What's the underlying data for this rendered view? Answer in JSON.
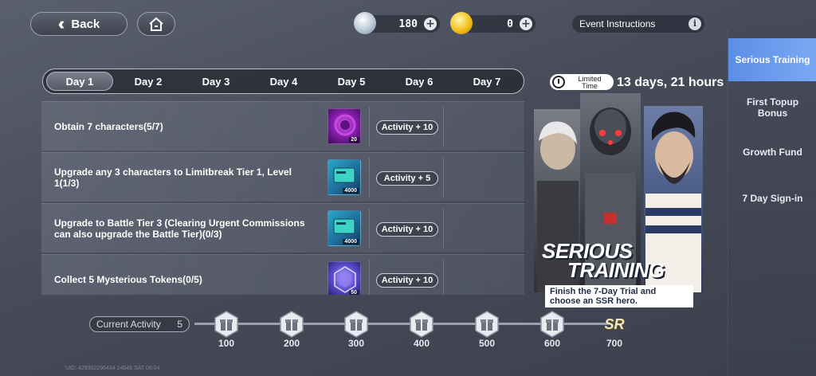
{
  "topbar": {
    "back_label": "Back",
    "silver_amount": "180",
    "gold_amount": "0",
    "event_instructions_label": "Event Instructions"
  },
  "sidebar": {
    "items": [
      {
        "label": "Serious Training",
        "active": true
      },
      {
        "label": "First Topup Bonus",
        "active": false
      },
      {
        "label": "Growth Fund",
        "active": false
      },
      {
        "label": "7 Day Sign-in",
        "active": false
      }
    ]
  },
  "days": {
    "tabs": [
      "Day 1",
      "Day 2",
      "Day 3",
      "Day 4",
      "Day 5",
      "Day 6",
      "Day 7"
    ],
    "active_index": 0
  },
  "tasks": [
    {
      "text": "Obtain 7 characters(5/7)",
      "reward": "Activity + 10",
      "item_qty": "20",
      "item_icon": "purple-orb-icon"
    },
    {
      "text": "Upgrade any 3 characters to Limitbreak Tier 1, Level 1(1/3)",
      "reward": "Activity + 5",
      "item_qty": "4000",
      "item_icon": "ticket-card-icon"
    },
    {
      "text": "Upgrade to Battle Tier 3 (Clearing Urgent Commissions can also upgrade the Battle Tier)(0/3)",
      "reward": "Activity + 10",
      "item_qty": "4000",
      "item_icon": "ticket-card-icon"
    },
    {
      "text": "Collect 5 Mysterious Tokens(0/5)",
      "reward": "Activity + 10",
      "item_qty": "50",
      "item_icon": "mysterious-cube-icon"
    }
  ],
  "banner": {
    "limited_label": "Limited Time",
    "time_remaining": "13 days, 21 hours",
    "title_line1": "SERIOUS",
    "title_line2": "TRAINING",
    "description": "Finish the 7-Day Trial and choose an SSR hero."
  },
  "progress": {
    "current_activity_label": "Current Activity",
    "current_activity_value": "5",
    "milestones": [
      "100",
      "200",
      "300",
      "400",
      "500",
      "600",
      "700"
    ],
    "final_reward_label": "SR"
  },
  "footer": {
    "uid": "UID: 429302296434 24646   SAT 08:04"
  },
  "colors": {
    "sidebar_active": "#6a9cee",
    "background": "#4a4e5c"
  }
}
